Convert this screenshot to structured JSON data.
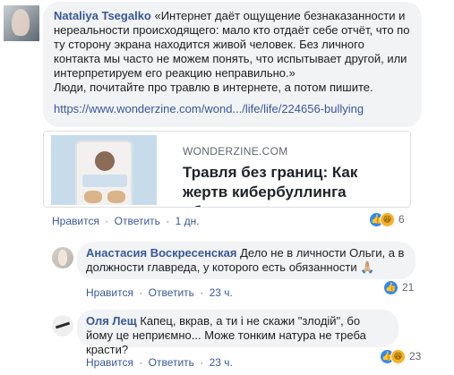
{
  "main_comment": {
    "author": "Nataliya Tsegalko",
    "text": " «Интернет даёт ощущение безнаказанности и нереальности происходящего: мало кто отдаёт себе отчёт, что по ту сторону экрана находится живой человек. Без личного контакта мы часто не можем понять, что испытывает другой, или интерпретируем его реакцию неправильно.»",
    "text2": "Люди, почитайте про травлю в интернете, а потом пишите.",
    "link": "https://www.wonderzine.com/wond.../life/life/224656-bullying",
    "preview": {
      "domain": "WONDERZINE.COM",
      "title": "Травля без границ: Как жертв кибербуллинга обвиняют в..."
    },
    "actions": {
      "like": "Нравится",
      "sep": "·",
      "reply": "Ответить",
      "time": "1 дн."
    },
    "reactions": {
      "count": "6",
      "icons": [
        "like-icon",
        "haha-icon"
      ]
    }
  },
  "replies": [
    {
      "author": "Анастасия Воскресенская",
      "text": " Дело не в личности Ольги, а в должности главреда, у которого есть обязанности 🙏🏼",
      "actions": {
        "like": "Нравится",
        "sep": "·",
        "reply": "Ответить",
        "time": "23 ч."
      },
      "reactions": {
        "count": "21",
        "icons": [
          "like-icon"
        ]
      }
    },
    {
      "author": "Оля Лещ",
      "text": " Капец, вкрав, а ти і не скажи \"злодій\", бо йому це неприємно... Може тонким натура не треба красти?",
      "actions": {
        "like": "Нравится",
        "sep": "·",
        "reply": "Ответить",
        "time": "23 ч."
      },
      "reactions": {
        "count": "23",
        "icons": [
          "like-icon",
          "haha-icon"
        ]
      }
    }
  ],
  "colors": {
    "author": "#385898",
    "bubble": "#f2f3f5",
    "like": "#2d88ff",
    "haha": "#f7b125"
  }
}
